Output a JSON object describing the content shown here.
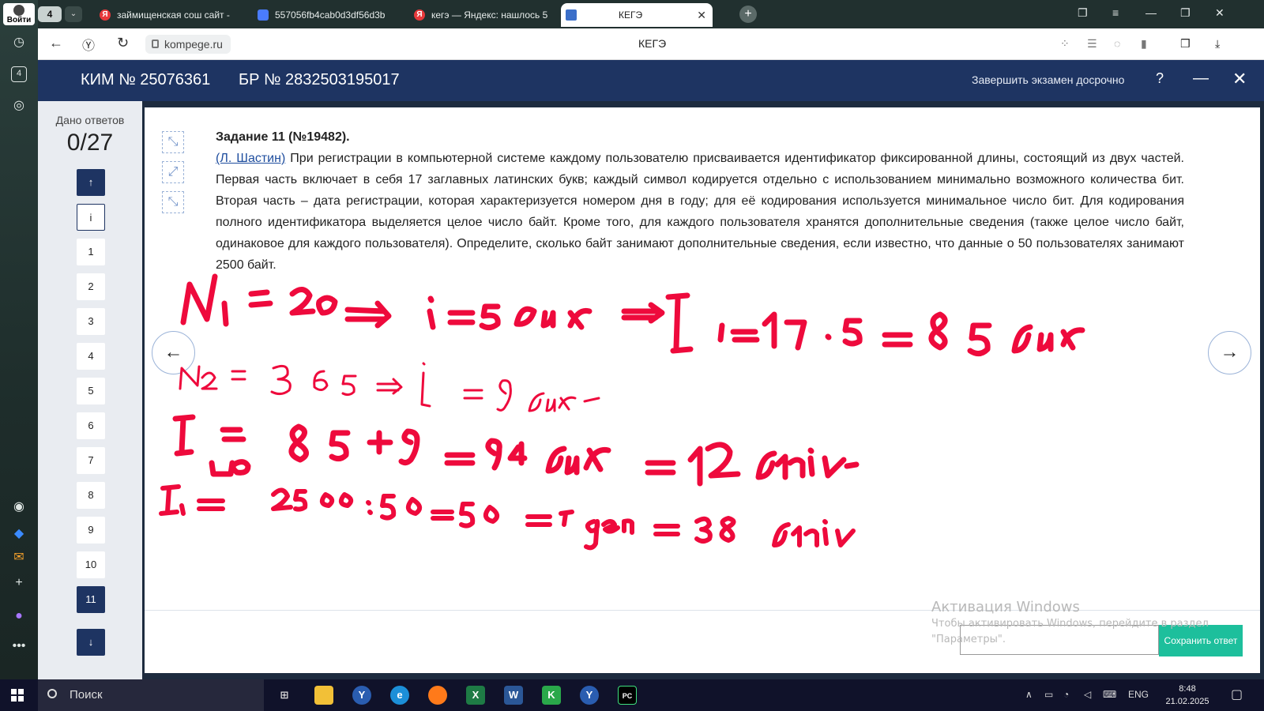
{
  "browser": {
    "login_label": "Войти",
    "tab_count": "4",
    "tabs": [
      {
        "title": "займищенская сош сайт -"
      },
      {
        "title": "557056fb4cab0d3df56d3b"
      },
      {
        "title": "кегэ — Яндекс: нашлось 5"
      },
      {
        "title": "КЕГЭ"
      }
    ],
    "url": "kompege.ru",
    "page_title": "КЕГЭ"
  },
  "header": {
    "kim": "КИМ № 25076361",
    "br": "БР № 2832503195017",
    "finish_label": "Завершить экзамен досрочно",
    "help": "?",
    "minimize": "—",
    "close": "✕"
  },
  "sidebar": {
    "answers_label": "Дано ответов",
    "answers_count": "0/27",
    "up": "↑",
    "info": "i",
    "questions": [
      "1",
      "2",
      "3",
      "4",
      "5",
      "6",
      "7",
      "8",
      "9",
      "10",
      "11"
    ],
    "current": "11",
    "down": "↓"
  },
  "task": {
    "title": "Задание 11 (№19482).",
    "author": "(Л. Шастин)",
    "text": " При регистрации в компьютерной системе каждому пользователю присваивается идентификатор фиксированной длины, состоящий из двух частей. Первая часть включает в себя 17 заглавных латинских букв; каждый символ кодируется отдельно с использованием минимально возможного количества бит. Вторая часть – дата регистрации, которая характеризуется номером дня в году; для её кодирования используется минимальное число бит. Для кодирования полного идентификатора выделяется целое число байт. Кроме того, для каждого пользователя хранятся дополнительные сведения (также целое число байт, одинаковое для каждого пользователя). Определите, сколько байт занимают дополнительные сведения, если известно, что данные о 50 пользователях занимают 2500 байт."
  },
  "nav": {
    "prev": "←",
    "next": "→"
  },
  "answer": {
    "value": "",
    "save_label": "Сохранить ответ"
  },
  "watermark": {
    "title": "Активация Windows",
    "line1": "Чтобы активировать Windows, перейдите в раздел",
    "line2": "\"Параметры\"."
  },
  "taskbar": {
    "search_label": "Поиск",
    "lang": "ENG",
    "time": "8:48",
    "date": "21.02.2025"
  },
  "colors": {
    "header": "#1e3462",
    "handwriting": "#ee0a3c",
    "save": "#1dbf9c"
  }
}
